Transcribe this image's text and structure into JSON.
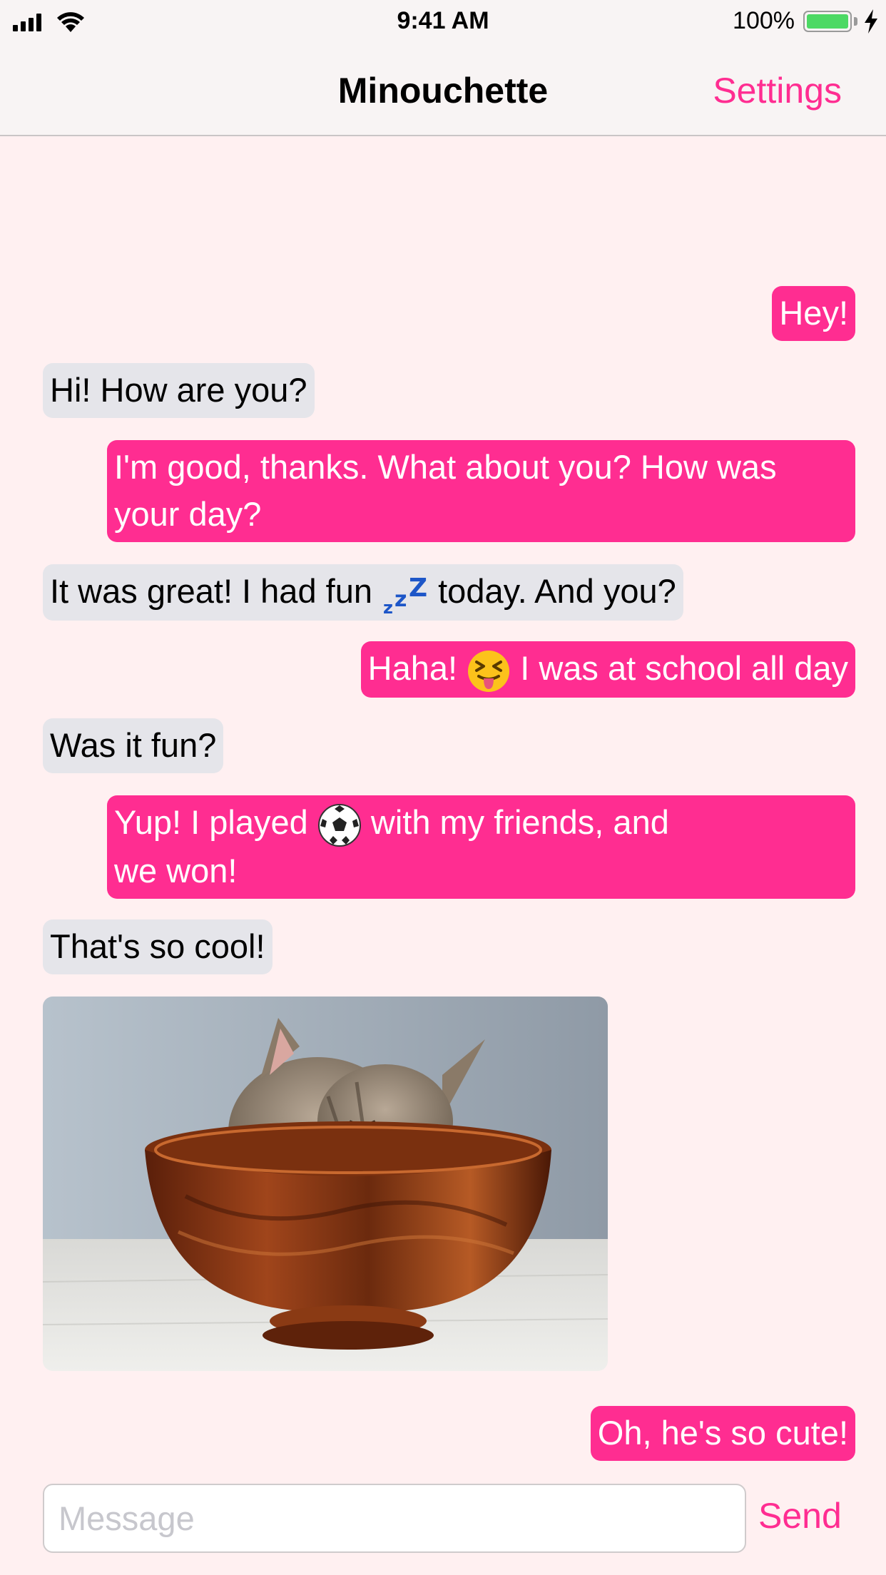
{
  "status_bar": {
    "time": "9:41 AM",
    "battery_percent": "100%",
    "battery_level": 1.0,
    "icons": [
      "signal-icon",
      "wifi-icon",
      "battery-icon",
      "charging-bolt-icon"
    ]
  },
  "nav": {
    "title": "Minouchette",
    "settings_label": "Settings"
  },
  "colors": {
    "accent": "#ff2d91",
    "incoming_bubble": "#e5e5ea",
    "background": "#fff0f1"
  },
  "messages": [
    {
      "direction": "outgoing",
      "text": "Hey!"
    },
    {
      "direction": "incoming",
      "text": "Hi! How are you?"
    },
    {
      "direction": "outgoing",
      "text": "I'm good, thanks. What about you? How was your day?"
    },
    {
      "direction": "incoming",
      "text_before": "It was great! I had fun",
      "emoji": "sleeping-zzz",
      "text_after": "today. And you?"
    },
    {
      "direction": "outgoing",
      "text_before": "Haha!",
      "emoji": "squinting-tongue-face",
      "text_after": "I was at school all day"
    },
    {
      "direction": "incoming",
      "text": "Was it fun?"
    },
    {
      "direction": "outgoing",
      "text_before": "Yup! I played",
      "emoji": "soccer-ball",
      "text_after": "with my friends, and",
      "text_line2": "we won!"
    },
    {
      "direction": "incoming",
      "text": "That's so cool!"
    },
    {
      "direction": "incoming",
      "type": "image",
      "image": "kitten sleeping in a wooden bowl"
    },
    {
      "direction": "outgoing",
      "text": "Oh, he's so cute!"
    }
  ],
  "composer": {
    "placeholder": "Message",
    "value": "",
    "send_label": "Send"
  }
}
